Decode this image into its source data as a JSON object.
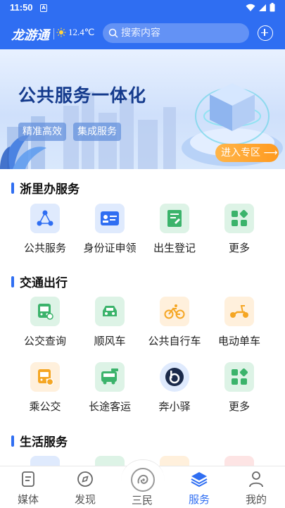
{
  "status_bar": {
    "time": "11:50",
    "notification_icon": "A"
  },
  "header": {
    "logo": "龙游通",
    "weather": "12.4℃",
    "search_placeholder": "搜索内容"
  },
  "banner": {
    "title": "公共服务一体化",
    "tags": [
      "精准高效",
      "集成服务"
    ],
    "enter_button": "进入专区"
  },
  "sections": {
    "zheli": {
      "title": "浙里办服务",
      "items": [
        {
          "label": "公共服务",
          "icon": "network-icon"
        },
        {
          "label": "身份证申领",
          "icon": "id-card-icon"
        },
        {
          "label": "出生登记",
          "icon": "register-icon"
        },
        {
          "label": "更多",
          "icon": "more-grid-icon"
        }
      ]
    },
    "traffic": {
      "title": "交通出行",
      "items": [
        {
          "label": "公交查询",
          "icon": "bus-search-icon"
        },
        {
          "label": "顺风车",
          "icon": "carpool-icon"
        },
        {
          "label": "公共自行车",
          "icon": "bicycle-icon"
        },
        {
          "label": "电动单车",
          "icon": "scooter-icon"
        },
        {
          "label": "乘公交",
          "icon": "bus-pay-icon"
        },
        {
          "label": "长途客运",
          "icon": "coach-icon"
        },
        {
          "label": "奔小驿",
          "icon": "benxiaoyi-icon"
        },
        {
          "label": "更多",
          "icon": "more-grid-icon"
        }
      ]
    },
    "life": {
      "title": "生活服务"
    }
  },
  "bottom_nav": [
    {
      "label": "媒体",
      "icon": "document-icon"
    },
    {
      "label": "发现",
      "icon": "compass-icon"
    },
    {
      "label": "三民",
      "icon": "sanmin-icon"
    },
    {
      "label": "服务",
      "icon": "layers-icon",
      "active": true
    },
    {
      "label": "我的",
      "icon": "person-icon"
    }
  ],
  "colors": {
    "primary": "#2f6ef2",
    "green": "#3bb36b",
    "orange": "#f5a623"
  }
}
